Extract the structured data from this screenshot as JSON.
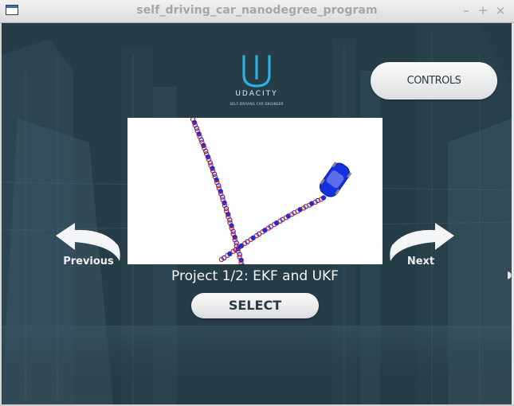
{
  "window": {
    "title": "self_driving_car_nanodegree_program",
    "min_glyph": "–",
    "max_glyph": "+",
    "close_glyph": "×"
  },
  "logo": {
    "name": "UDACITY",
    "tagline": "SELF-DRIVING CAR ENGINEER",
    "color": "#2fb0e3"
  },
  "controls": {
    "label": "CONTROLS"
  },
  "navigation": {
    "previous_label": "Previous",
    "next_label": "Next"
  },
  "project": {
    "title": "Project 1/2: EKF and UKF",
    "select_label": "SELECT"
  },
  "icons": {
    "app": "window-icon",
    "previous": "curved-arrow-left-icon",
    "next": "curved-arrow-right-icon",
    "car": "car-icon"
  },
  "colors": {
    "marker_red": "#e01818",
    "marker_blue": "#1a2fd6",
    "car_blue": "#1430e0"
  }
}
